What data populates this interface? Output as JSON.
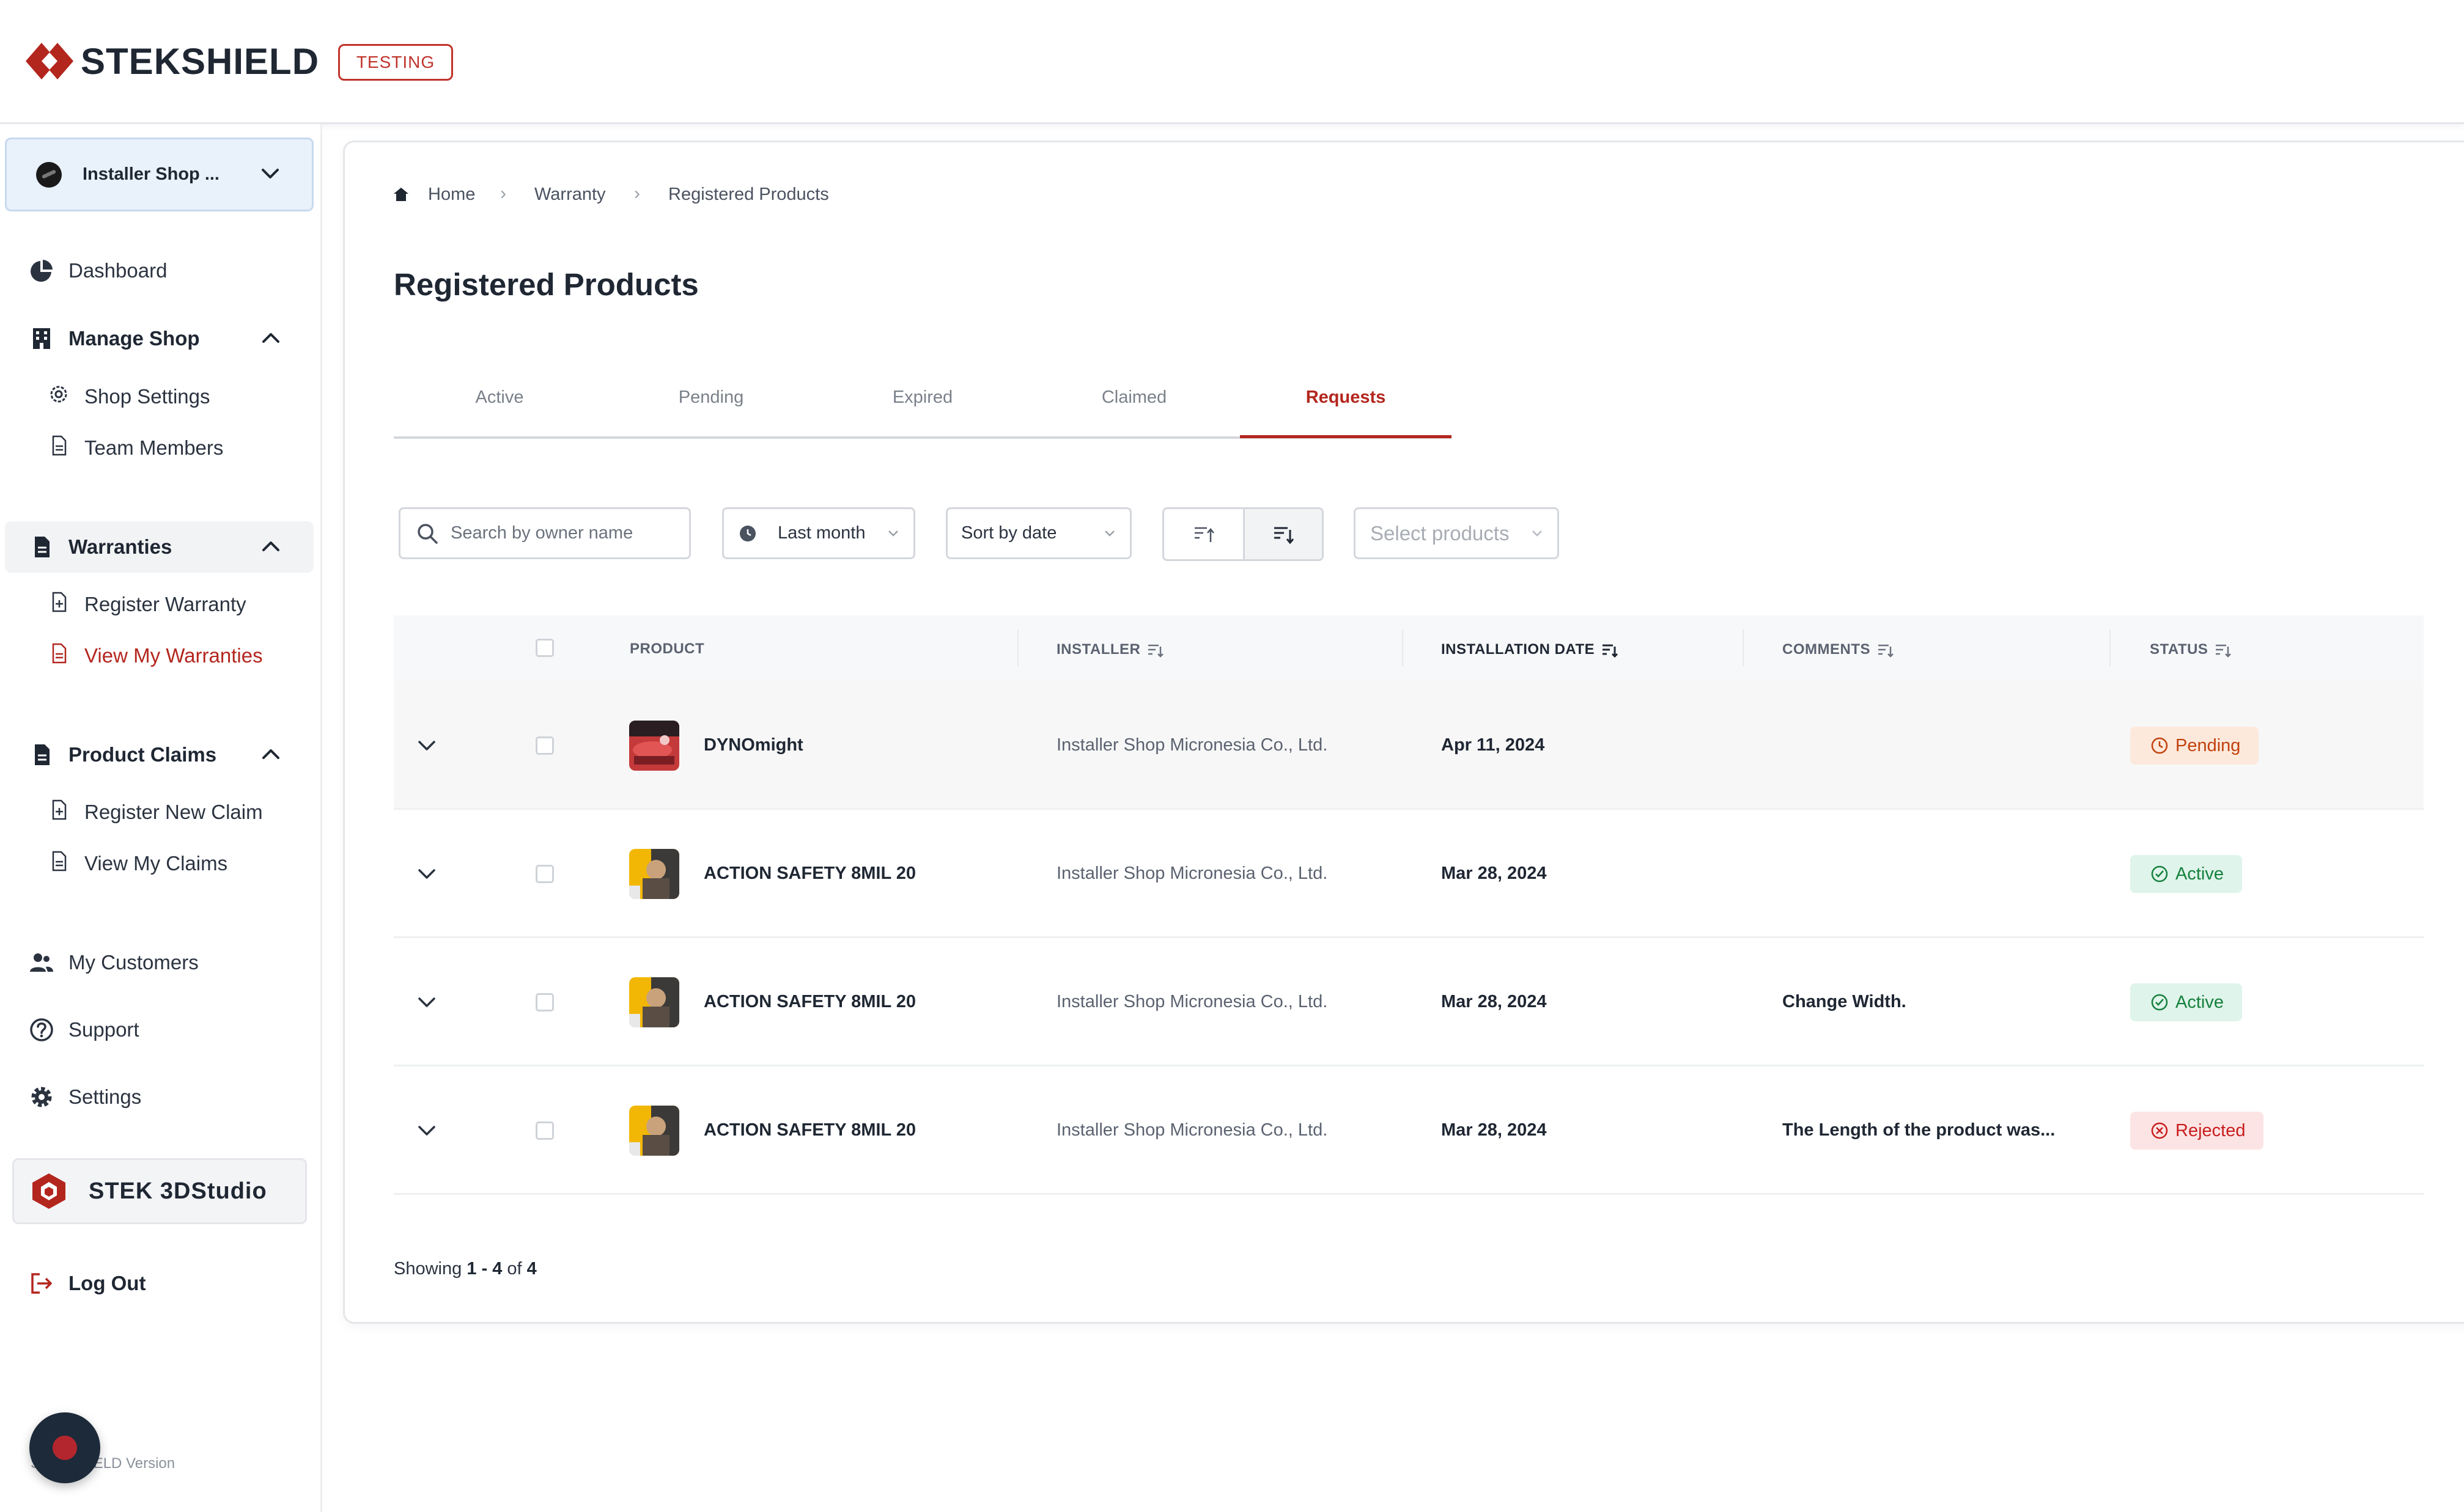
{
  "brand": {
    "name": "STEKSHIELD",
    "env_badge": "TESTING",
    "accent": "#b3261e"
  },
  "sidebar": {
    "shop_selector": {
      "name": "Installer Shop ..."
    },
    "dashboard": "Dashboard",
    "manage_shop": {
      "label": "Manage Shop",
      "items": [
        "Shop Settings",
        "Team Members"
      ]
    },
    "warranties": {
      "label": "Warranties",
      "items": [
        "Register Warranty",
        "View My Warranties"
      ]
    },
    "product_claims": {
      "label": "Product Claims",
      "items": [
        "Register New Claim",
        "View My Claims"
      ]
    },
    "my_customers": "My Customers",
    "support": "Support",
    "settings": "Settings",
    "stek_studio": "STEK 3DStudio",
    "logout": "Log Out",
    "version": "STEKSHIELD Version"
  },
  "breadcrumb": [
    "Home",
    "Warranty",
    "Registered Products"
  ],
  "page_title": "Registered Products",
  "tabs": [
    {
      "label": "Active"
    },
    {
      "label": "Pending"
    },
    {
      "label": "Expired"
    },
    {
      "label": "Claimed"
    },
    {
      "label": "Requests",
      "active": true
    }
  ],
  "filters": {
    "search_placeholder": "Search by owner name",
    "date_range": "Last month",
    "sort": "Sort by date",
    "products_placeholder": "Select products"
  },
  "table": {
    "columns": [
      "PRODUCT",
      "INSTALLER",
      "INSTALLATION DATE",
      "COMMENTS",
      "STATUS"
    ],
    "rows": [
      {
        "product": "DYNOmight",
        "installer": "Installer Shop Micronesia Co., Ltd.",
        "date": "Apr 11, 2024",
        "comments": "",
        "status": "Pending"
      },
      {
        "product": "ACTION SAFETY 8MIL 20",
        "installer": "Installer Shop Micronesia Co., Ltd.",
        "date": "Mar 28, 2024",
        "comments": "",
        "status": "Active"
      },
      {
        "product": "ACTION SAFETY 8MIL 20",
        "installer": "Installer Shop Micronesia Co., Ltd.",
        "date": "Mar 28, 2024",
        "comments": "Change Width.",
        "status": "Active"
      },
      {
        "product": "ACTION SAFETY 8MIL 20",
        "installer": "Installer Shop Micronesia Co., Ltd.",
        "date": "Mar 28, 2024",
        "comments": "The Length of the product was...",
        "status": "Rejected"
      }
    ]
  },
  "pagination": {
    "prefix": "Showing",
    "range": "1 - 4",
    "of": "of",
    "total": "4"
  }
}
